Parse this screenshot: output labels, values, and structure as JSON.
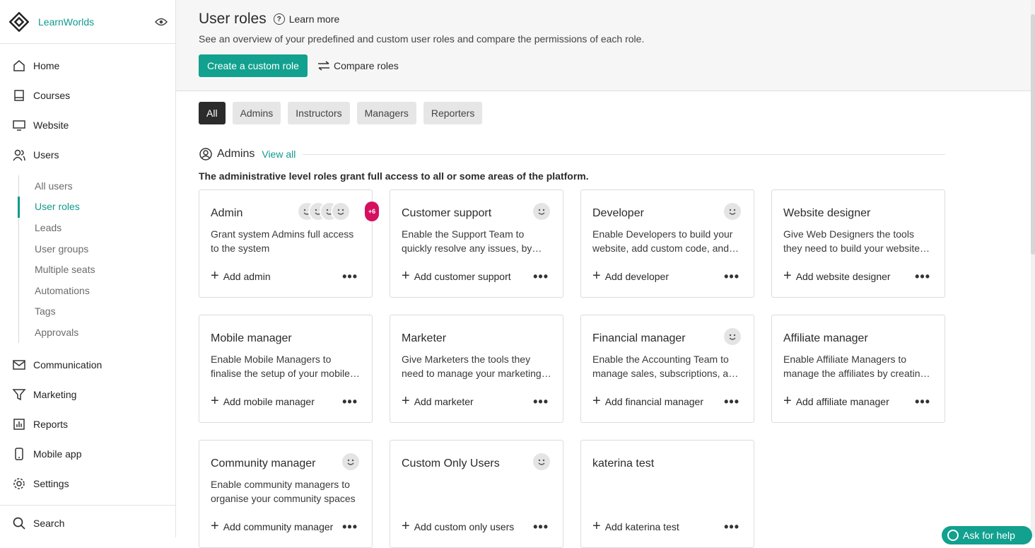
{
  "brand": {
    "name": "LearnWorlds",
    "color": "#0f9a8e"
  },
  "nav": {
    "items": [
      {
        "label": "Home",
        "icon": "home-icon"
      },
      {
        "label": "Courses",
        "icon": "book-icon"
      },
      {
        "label": "Website",
        "icon": "monitor-icon"
      },
      {
        "label": "Users",
        "icon": "users-icon"
      }
    ],
    "users_sub": [
      "All users",
      "User roles",
      "Leads",
      "User groups",
      "Multiple seats",
      "Automations",
      "Tags",
      "Approvals"
    ],
    "items2": [
      {
        "label": "Communication",
        "icon": "mail-icon"
      },
      {
        "label": "Marketing",
        "icon": "funnel-icon"
      },
      {
        "label": "Reports",
        "icon": "chart-icon"
      },
      {
        "label": "Mobile app",
        "icon": "phone-icon"
      },
      {
        "label": "Settings",
        "icon": "gear-icon"
      }
    ],
    "search": "Search"
  },
  "header": {
    "title": "User roles",
    "learn_more": "Learn more",
    "subtitle": "See an overview of your predefined and custom user roles and compare the permissions of each role.",
    "create_button": "Create a custom role",
    "compare_button": "Compare roles"
  },
  "filters": [
    "All",
    "Admins",
    "Instructors",
    "Managers",
    "Reporters"
  ],
  "section": {
    "title": "Admins",
    "view_all": "View all",
    "description": "The administrative level roles grant full access to all or some areas of the platform."
  },
  "cards": [
    {
      "title": "Admin",
      "desc": "Grant system Admins full access to the system",
      "add": "Add admin",
      "avatars": "group",
      "count": "+6"
    },
    {
      "title": "Customer support",
      "desc": "Enable the Support Team to quickly resolve any issues, by answering questions",
      "add": "Add customer support",
      "avatars": "single"
    },
    {
      "title": "Developer",
      "desc": "Enable Developers to build your website, add custom code, and more",
      "add": "Add developer",
      "avatars": "single"
    },
    {
      "title": "Website designer",
      "desc": "Give Web Designers the tools they need to build your website and pages",
      "add": "Add website designer",
      "avatars": "none"
    },
    {
      "title": "Mobile manager",
      "desc": "Enable Mobile Managers to finalise the setup of your mobile app",
      "add": "Add mobile manager",
      "avatars": "none"
    },
    {
      "title": "Marketer",
      "desc": "Give Marketers the tools they need to manage your marketing campaigns",
      "add": "Add marketer",
      "avatars": "none"
    },
    {
      "title": "Financial manager",
      "desc": "Enable the Accounting Team to manage sales, subscriptions, and payouts",
      "add": "Add financial manager",
      "avatars": "single"
    },
    {
      "title": "Affiliate manager",
      "desc": "Enable Affiliate Managers to manage the affiliates by creating programs",
      "add": "Add affiliate manager",
      "avatars": "none"
    },
    {
      "title": "Community manager",
      "desc": "Enable community managers to organise your community spaces",
      "add": "Add community manager",
      "avatars": "single"
    },
    {
      "title": "Custom Only Users",
      "desc": "",
      "add": "Add custom only users",
      "avatars": "single"
    },
    {
      "title": "katerina test",
      "desc": "",
      "add": "Add katerina test",
      "avatars": "none"
    }
  ],
  "help": "Ask for help"
}
